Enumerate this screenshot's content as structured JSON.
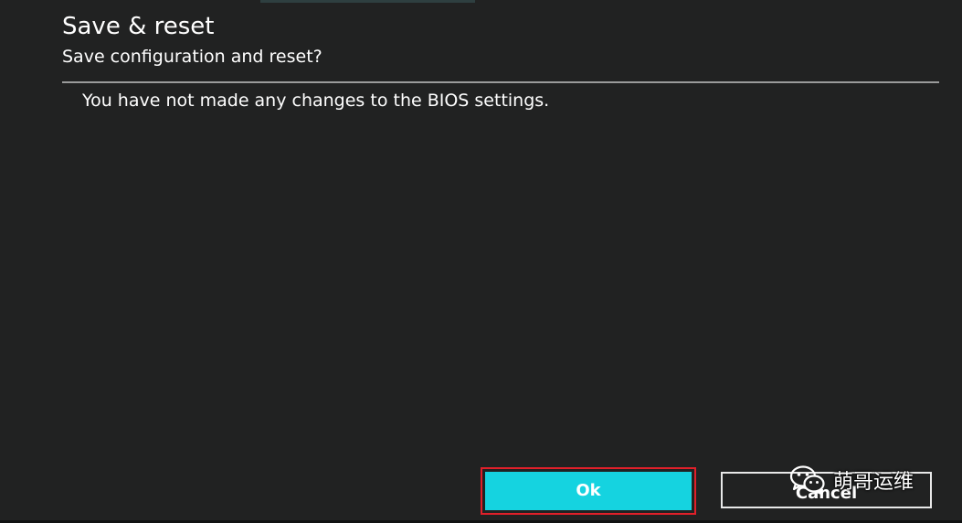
{
  "dialog": {
    "title": "Save & reset",
    "subtitle": "Save configuration and reset?",
    "message": "You have not made any changes to the BIOS settings."
  },
  "buttons": {
    "ok_label": "Ok",
    "cancel_label": "Cancel"
  },
  "watermark": {
    "icon": "wechat-logo",
    "text": "萌哥运维"
  },
  "colors": {
    "background": "#212222",
    "accent": "#15d3e0",
    "highlight_border": "#e0202a",
    "divider": "#9a9b9b",
    "text": "#ffffff"
  }
}
